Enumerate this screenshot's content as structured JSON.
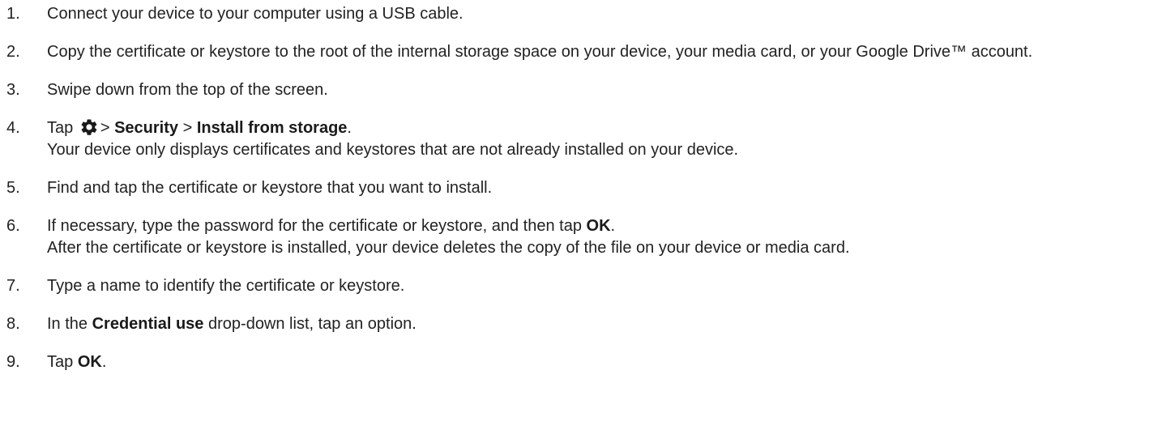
{
  "steps": [
    {
      "num": "1.",
      "text": "Connect your device to your computer using a USB cable."
    },
    {
      "num": "2.",
      "text": "Copy the certificate or keystore to the root of the internal storage space on your device, your media card, or your Google Drive™ account."
    },
    {
      "num": "3.",
      "text": "Swipe down from the top of the screen."
    },
    {
      "num": "4.",
      "tap": "Tap",
      "icon": "settings-gear-icon",
      "sep1": ">",
      "security": "Security",
      "sep2": ">",
      "install": "Install from storage",
      "period": ".",
      "note": "Your device only displays certificates and keystores that are not already installed on your device."
    },
    {
      "num": "5.",
      "text": "Find and tap the certificate or keystore that you want to install."
    },
    {
      "num": "6.",
      "pre": "If necessary, type the password for the certificate or keystore, and then tap",
      "ok": "OK",
      "period": ".",
      "note": "After the certificate or keystore is installed, your device deletes the copy of the file on your device or media card."
    },
    {
      "num": "7.",
      "text": "Type a name to identify the certificate or keystore."
    },
    {
      "num": "8.",
      "pre": "In the",
      "credential": "Credential use",
      "post": "drop-down list, tap an option."
    },
    {
      "num": "9.",
      "tap": "Tap",
      "ok": "OK",
      "period": "."
    }
  ]
}
